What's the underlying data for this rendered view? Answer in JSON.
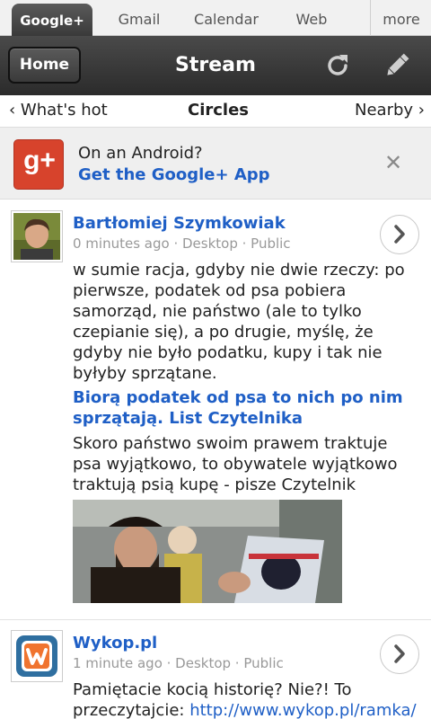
{
  "app_tabs": [
    "Google+",
    "Gmail",
    "Calendar",
    "Web",
    "more"
  ],
  "header": {
    "home_label": "Home",
    "title": "Stream"
  },
  "subnav": {
    "left": "What's hot",
    "center": "Circles",
    "right": "Nearby"
  },
  "promo": {
    "title": "On an Android?",
    "link": "Get the Google+ App",
    "logo_text": "g+"
  },
  "posts": [
    {
      "author": "Bartłomiej Szymkowiak",
      "meta": "0 minutes ago · Desktop · Public",
      "text": "w sumie racja, gdyby nie dwie rzeczy: po pierwsze, podatek od psa pobiera samorząd, nie państwo (ale to tylko czepianie się), a po drugie, myślę, że gdyby nie było podatku, kupy i tak nie byłyby sprzątane.",
      "link_title": "Biorą podatek od psa to nich po nim sprzątają. List Czytelnika",
      "link_desc": "Skoro państwo swoim prawem traktuje psa wyjątkowo, to obywatele wyjątkowo traktują psią kupę - pisze Czytelnik"
    },
    {
      "author": "Wykop.pl",
      "meta": "1 minute ago · Desktop · Public",
      "text": "Pamiętacie kocią historię? Nie?! To przeczytajcie: ",
      "url": "http://www.wykop.pl/ramka/"
    }
  ],
  "colors": {
    "link": "#1f5fc6",
    "header_dark": "#2b2b2b",
    "gplus_red": "#d7432c",
    "wykop_blue": "#2f6fa0",
    "wykop_orange": "#f0742f"
  }
}
